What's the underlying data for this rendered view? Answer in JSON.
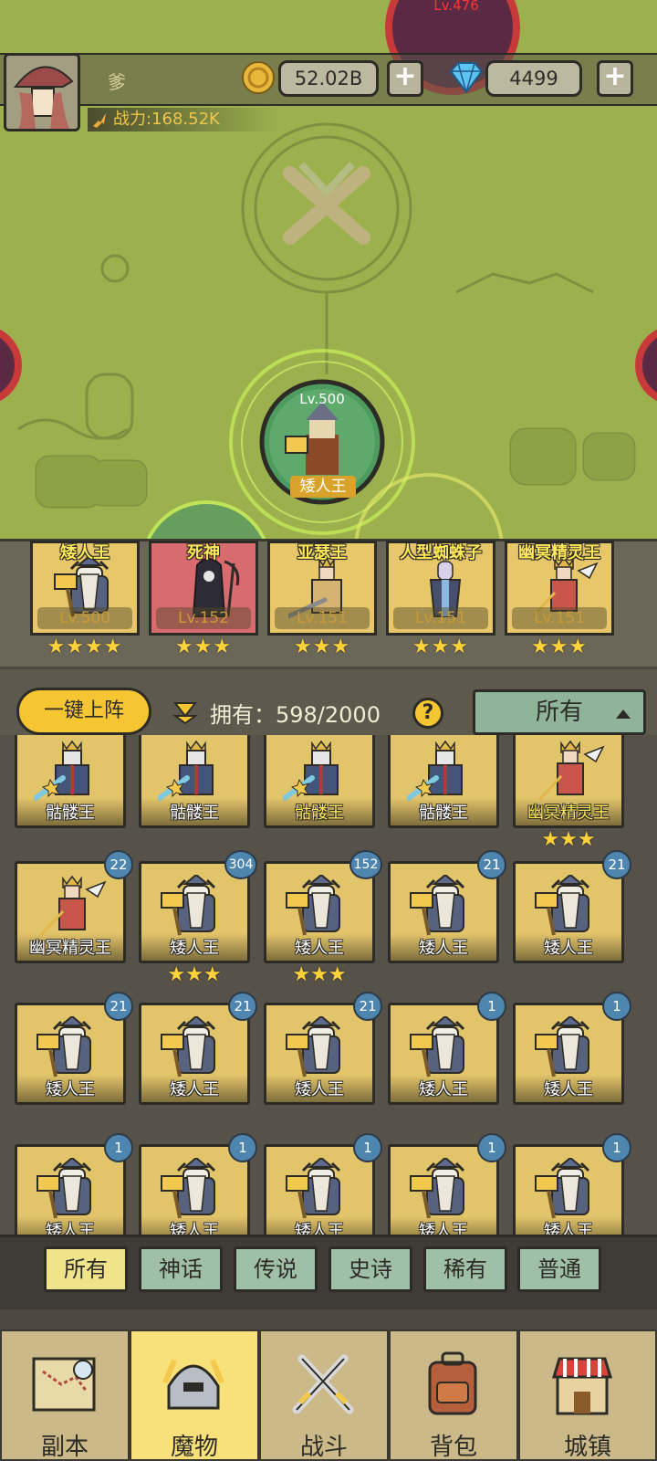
{
  "player": {
    "name": "爹",
    "power": "战力:168.52K",
    "gold": "52.02B",
    "gems": "4499"
  },
  "map": {
    "boss_level": "Lv.500",
    "boss_name": "矮人王",
    "top_enemy_level": "Lv.476"
  },
  "team": [
    {
      "name": "矮人王",
      "level": "Lv.500",
      "stars": "★★★★",
      "bg": "gold"
    },
    {
      "name": "死神",
      "level": "Lv.152",
      "stars": "★★★",
      "bg": "red"
    },
    {
      "name": "亚瑟王",
      "level": "Lv.151",
      "stars": "★★★",
      "bg": "gold"
    },
    {
      "name": "人型蜘蛛子",
      "level": "Lv.151",
      "stars": "★★★",
      "bg": "gold"
    },
    {
      "name": "幽冥精灵王",
      "level": "Lv.151",
      "stars": "★★★",
      "bg": "gold"
    }
  ],
  "toolbar": {
    "deploy_label": "一键上阵",
    "owned_label": "拥有：598/2000",
    "help": "?",
    "sort_label": "所有"
  },
  "grid": [
    [
      {
        "name": "骷髅王",
        "badge": "",
        "stars": "",
        "gold": false
      },
      {
        "name": "骷髅王",
        "badge": "",
        "stars": "",
        "gold": false
      },
      {
        "name": "骷髅王",
        "badge": "",
        "stars": "",
        "gold": true
      },
      {
        "name": "骷髅王",
        "badge": "",
        "stars": "",
        "gold": false
      },
      {
        "name": "幽冥精灵王",
        "badge": "",
        "stars": "★★★",
        "gold": true
      }
    ],
    [
      {
        "name": "幽冥精灵王",
        "badge": "22",
        "stars": "",
        "gold": false
      },
      {
        "name": "矮人王",
        "badge": "304",
        "stars": "★★★",
        "gold": false
      },
      {
        "name": "矮人王",
        "badge": "152",
        "stars": "★★★",
        "gold": false
      },
      {
        "name": "矮人王",
        "badge": "21",
        "stars": "",
        "gold": false
      },
      {
        "name": "矮人王",
        "badge": "21",
        "stars": "",
        "gold": false
      }
    ],
    [
      {
        "name": "矮人王",
        "badge": "21",
        "stars": "",
        "gold": false
      },
      {
        "name": "矮人王",
        "badge": "21",
        "stars": "",
        "gold": false
      },
      {
        "name": "矮人王",
        "badge": "21",
        "stars": "",
        "gold": false
      },
      {
        "name": "矮人王",
        "badge": "1",
        "stars": "",
        "gold": false
      },
      {
        "name": "矮人王",
        "badge": "1",
        "stars": "",
        "gold": false
      }
    ],
    [
      {
        "name": "矮人王",
        "badge": "1",
        "stars": "",
        "gold": false
      },
      {
        "name": "矮人王",
        "badge": "1",
        "stars": "",
        "gold": false
      },
      {
        "name": "矮人王",
        "badge": "1",
        "stars": "",
        "gold": false
      },
      {
        "name": "矮人王",
        "badge": "1",
        "stars": "",
        "gold": false
      },
      {
        "name": "矮人王",
        "badge": "1",
        "stars": "",
        "gold": false
      }
    ]
  ],
  "rarity_tabs": [
    "所有",
    "神话",
    "传说",
    "史诗",
    "稀有",
    "普通"
  ],
  "nav": [
    {
      "label": "副本",
      "icon": "map-scroll-icon"
    },
    {
      "label": "魔物",
      "icon": "monster-helmet-icon"
    },
    {
      "label": "战斗",
      "icon": "crossed-swords-icon"
    },
    {
      "label": "背包",
      "icon": "backpack-icon"
    },
    {
      "label": "城镇",
      "icon": "town-shop-icon"
    }
  ],
  "colors": {
    "map_green": "#9db04e",
    "card_gold": "#e2c46a",
    "badge_blue": "#4f86b0",
    "accent_yellow": "#f6c532",
    "tab_green": "#9fbfa6"
  }
}
